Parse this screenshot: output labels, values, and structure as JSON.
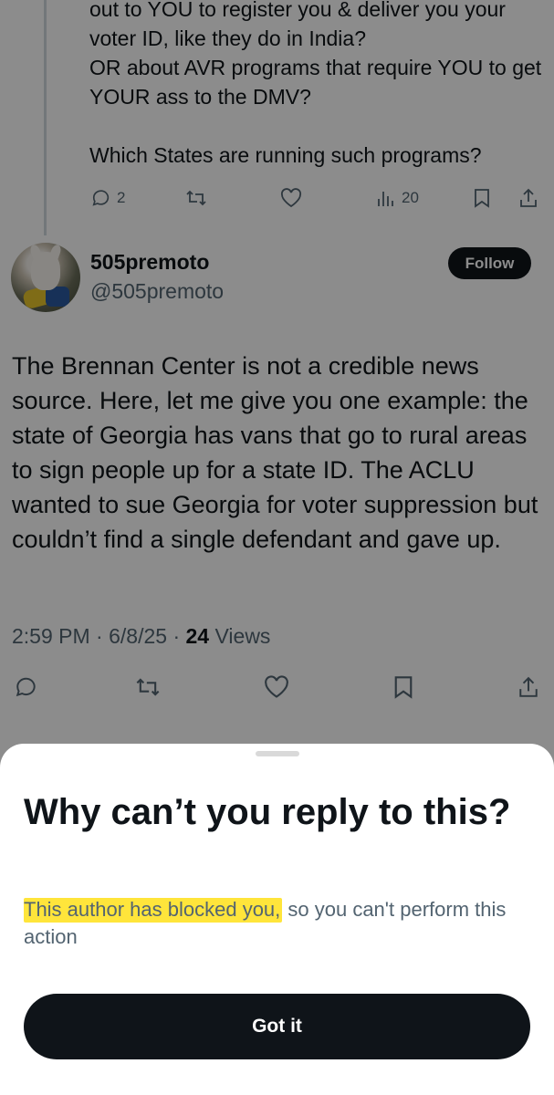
{
  "parent_tweet": {
    "text": "out to YOU to register you &  deliver you your voter ID, like they do in India?\nOR about AVR programs that require YOU to get YOUR ass to the DMV?\n\nWhich States are running such programs?",
    "reply_count": "2",
    "views": "20",
    "icons": [
      "reply-icon",
      "retweet-icon",
      "like-icon",
      "views-icon",
      "bookmark-icon",
      "share-icon"
    ]
  },
  "tweet": {
    "display_name": "505premoto",
    "handle": "@505premoto",
    "follow_label": "Follow",
    "body": "The Brennan Center is not a credible news source. Here, let me give you one example: the state of Georgia has vans that go to rural areas to sign people up for a state ID. The ACLU wanted to sue Georgia for voter suppression but couldn’t find a single defendant and gave up.",
    "time": "2:59 PM",
    "date": "6/8/25",
    "views_count": "24",
    "views_label": "Views",
    "sep": "·",
    "icons": [
      "reply-icon",
      "retweet-icon",
      "like-icon",
      "bookmark-icon",
      "share-icon"
    ]
  },
  "sheet": {
    "title": "Why can’t you reply to this?",
    "desc_highlight": "This author has blocked you,",
    "desc_rest": " so you can't perform this action",
    "button_label": "Got it",
    "highlight_color": "#ffe53b"
  },
  "colors": {
    "text": "#0f1419",
    "secondary": "#536471",
    "scrim": "rgba(0,0,0,0.45)"
  }
}
